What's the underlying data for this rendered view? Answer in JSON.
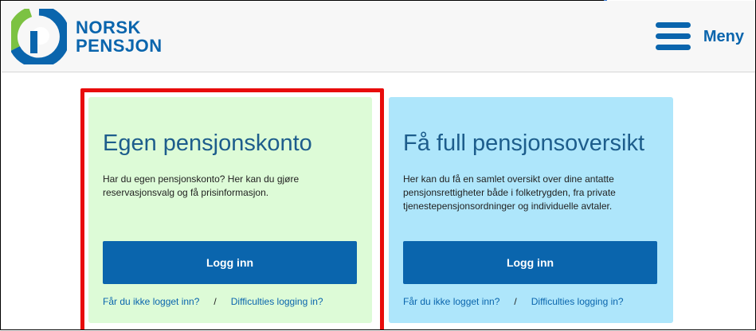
{
  "header": {
    "brand_line1": "NORSK",
    "brand_line2": "PENSJON",
    "logo_icon": "norsk-pensjon-logo-icon",
    "menu_label": "Meny",
    "menu_icon": "hamburger-menu-icon"
  },
  "cards": [
    {
      "title": "Egen pensjonskonto",
      "description": "Har du egen pensjonskonto? Her kan du gjøre reservasjonsvalg og få prisinformasjon.",
      "login_label": "Logg inn",
      "help_link": "Får du ikke logget inn?",
      "separator": "/",
      "english_link": "Difficulties logging in?",
      "background": "#ddfbd7",
      "highlighted": true
    },
    {
      "title": "Få full pensjonsoversikt",
      "description": "Her kan du få en samlet oversikt over dine antatte pensjonsrettigheter både i folketrygden, fra private tjenestepensjonsordninger og individuelle avtaler.",
      "login_label": "Logg inn",
      "help_link": "Får du ikke logget inn?",
      "separator": "/",
      "english_link": "Difficulties logging in?",
      "background": "#aee6fb",
      "highlighted": false
    }
  ],
  "colors": {
    "brand_blue": "#0a65ad",
    "logo_green": "#7cc242",
    "highlight_red": "#e80c0c"
  }
}
